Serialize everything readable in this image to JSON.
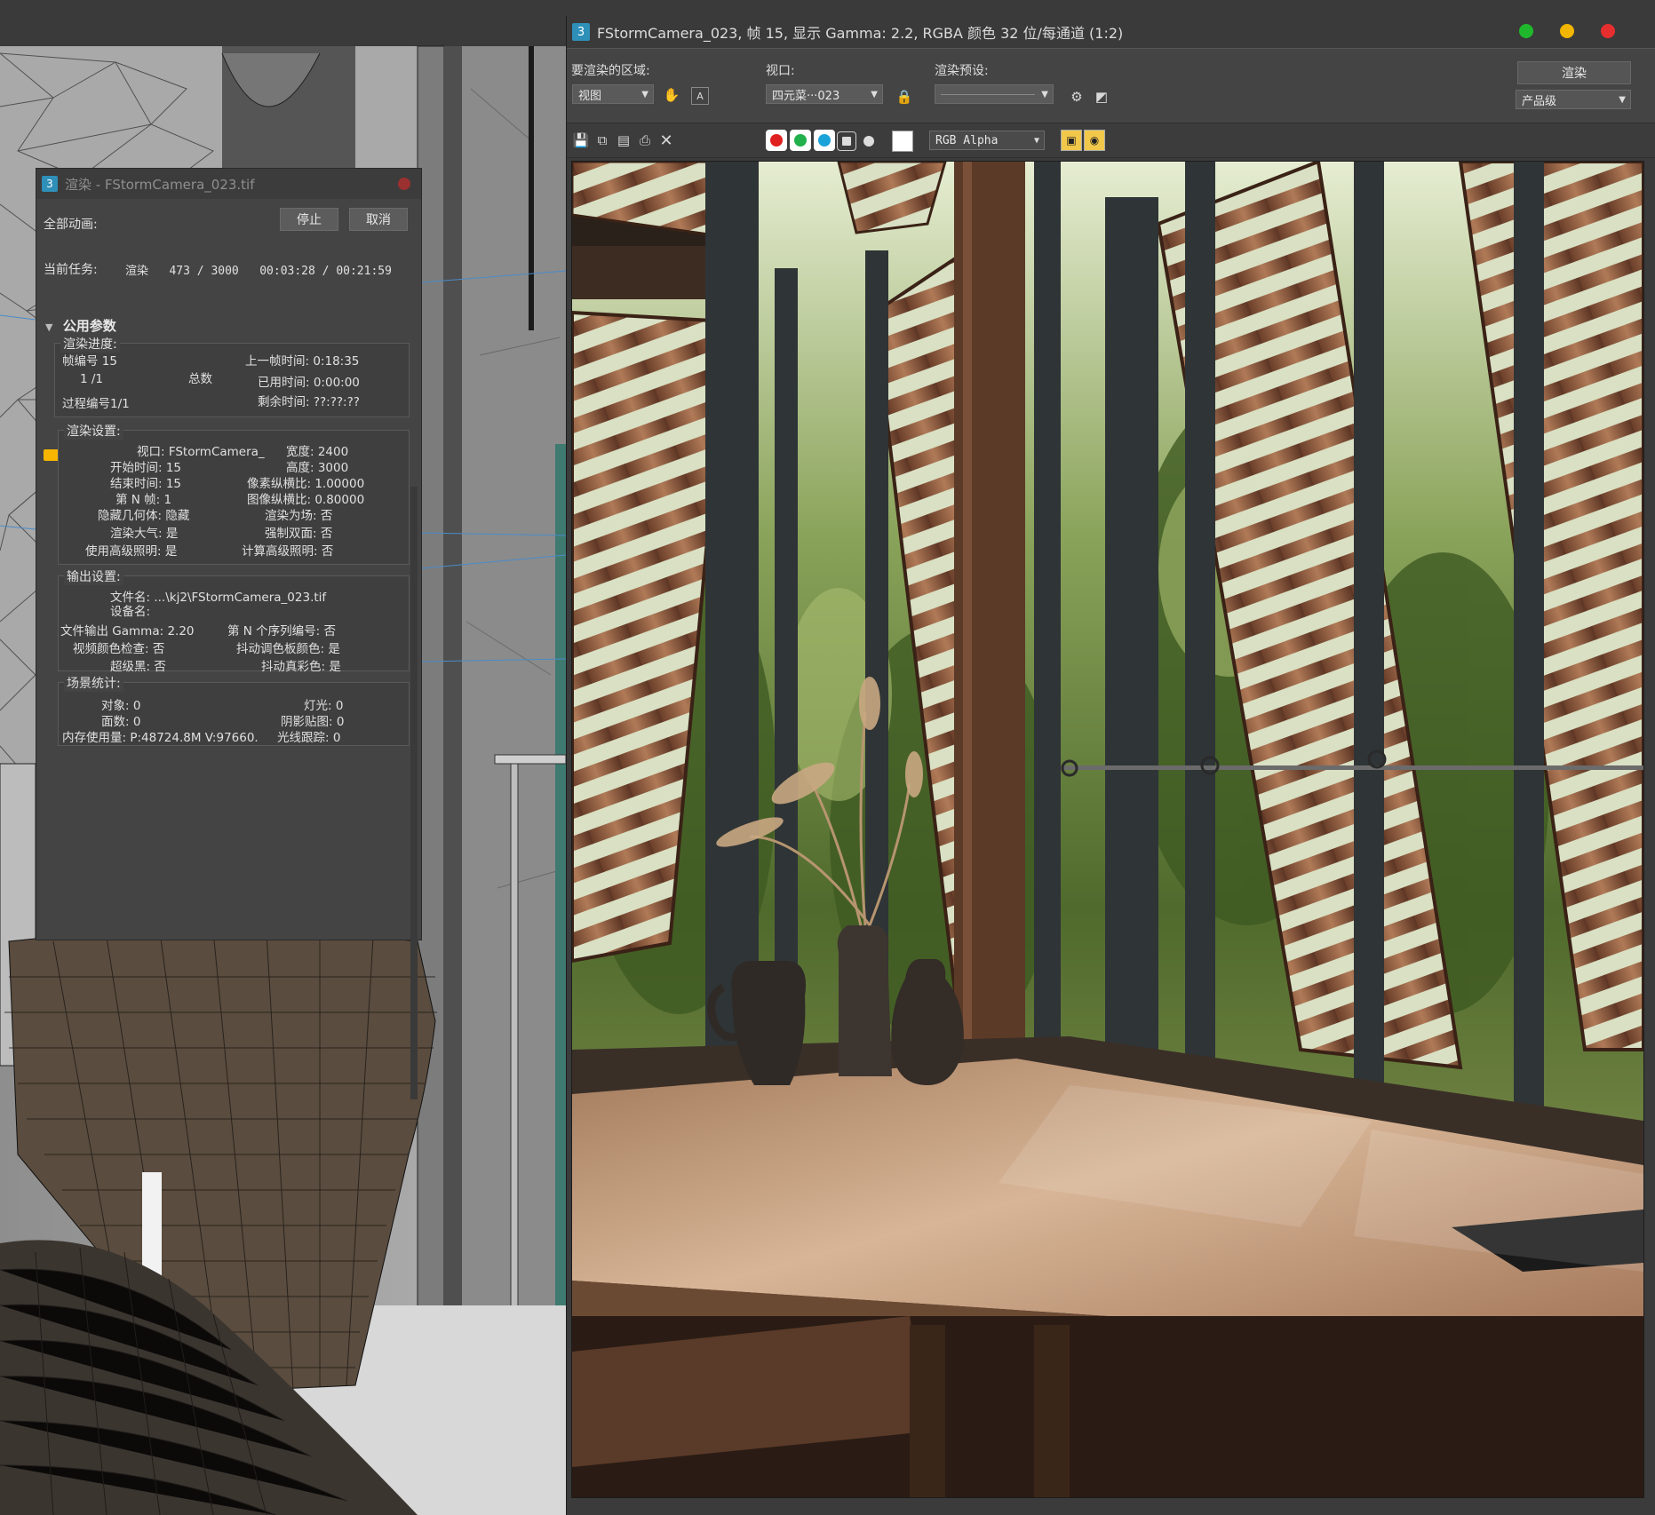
{
  "render_progress": {
    "title": "渲染 - FStormCamera_023.tif",
    "all_animation_label": "全部动画:",
    "stop_button": "停止",
    "cancel_button": "取消",
    "current_task_label": "当前任务:",
    "current_task_value": "渲染   473 / 3000   00:03:28 / 00:21:59",
    "progress_fraction": 0.158,
    "common_params_heading": "公用参数",
    "render_progress_group": {
      "label": "渲染进度:",
      "frame_number": "帧编号  15",
      "last_frame_time": "上一帧时间:  0:18:35",
      "frame_count": "1 /1",
      "total": "总数",
      "elapsed_time": "已用时间:  0:00:00",
      "pass_number": "过程编号1/1",
      "remaining_time": "剩余时间: ??:??:??"
    },
    "render_settings_group": {
      "label": "渲染设置:",
      "viewport": "视口: FStormCamera_",
      "width": "宽度: 2400",
      "start_time": "开始时间: 15",
      "height": "高度: 3000",
      "end_time": "结束时间: 15",
      "pixel_aspect": "像素纵横比: 1.00000",
      "nth_frame": "第 N 帧: 1",
      "image_aspect": "图像纵横比: 0.80000",
      "hidden_geometry": "隐藏几何体: 隐藏",
      "render_to_fields": "渲染为场: 否",
      "atmosphere": "渲染大气: 是",
      "force_2sided": "强制双面: 否",
      "use_adv_lighting": "使用高级照明: 是",
      "compute_adv_lighting": "计算高级照明: 否"
    },
    "output_settings_group": {
      "label": "输出设置:",
      "file_name": "文件名: ...\\kj2\\FStormCamera_023.tif",
      "device_name": "设备名:",
      "file_output_gamma": "文件输出 Gamma: 2.20",
      "nth_serial": "第 N 个序列编号: 否",
      "video_color_check": "视频颜色检查: 否",
      "dither_paletted": "抖动调色板颜色: 是",
      "super_black": "超级黑: 否",
      "dither_true_color": "抖动真彩色: 是"
    },
    "scene_stats_group": {
      "label": "场景统计:",
      "objects": "对象: 0",
      "lights": "灯光: 0",
      "faces": "面数: 0",
      "shadow_maps": "阴影贴图: 0",
      "memory": "内存使用量: P:48724.8M V:97660.",
      "raytrace": "光线跟踪: 0"
    }
  },
  "frame_window": {
    "title": "FStormCamera_023, 帧 15, 显示 Gamma: 2.2, RGBA 颜色 32 位/每通道 (1:2)",
    "area_to_render_label": "要渲染的区域:",
    "area_to_render_value": "视图",
    "viewport_label": "视口:",
    "viewport_value": "四元菜···023",
    "render_preset_label": "渲染预设:",
    "render_preset_value": "",
    "render_button": "渲染",
    "quality_value": "产品级",
    "channel_value": "RGB Alpha",
    "colors": {
      "red_channel": "#e02020",
      "green_channel": "#22b14c",
      "blue_channel": "#1aa3d9",
      "traffic_green": "#1fb82c",
      "traffic_yellow": "#f2b600",
      "traffic_red": "#e62e2e"
    }
  }
}
